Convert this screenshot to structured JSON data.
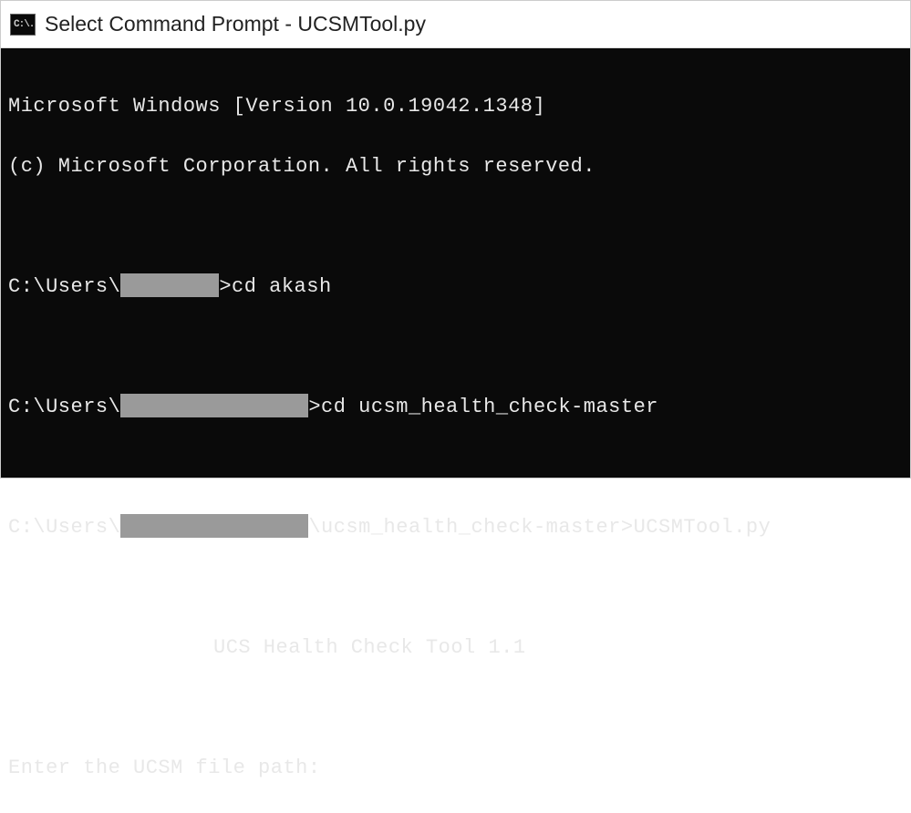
{
  "titlebar": {
    "icon_text": "C:\\.",
    "title": "Select Command Prompt - UCSMTool.py"
  },
  "terminal": {
    "line1": "Microsoft Windows [Version 10.0.19042.1348]",
    "line2": "(c) Microsoft Corporation. All rights reserved.",
    "prompt1_prefix": "C:\\Users\\",
    "prompt1_suffix": ">cd akash",
    "prompt2_prefix": "C:\\Users\\",
    "prompt2_suffix": ">cd ucsm_health_check-master",
    "prompt3_prefix": "C:\\Users\\",
    "prompt3_suffix": "\\ucsm_health_check-master>UCSMTool.py",
    "tool_header": "UCS Health Check Tool 1.1",
    "input_prompt": "Enter the UCSM file path: "
  }
}
